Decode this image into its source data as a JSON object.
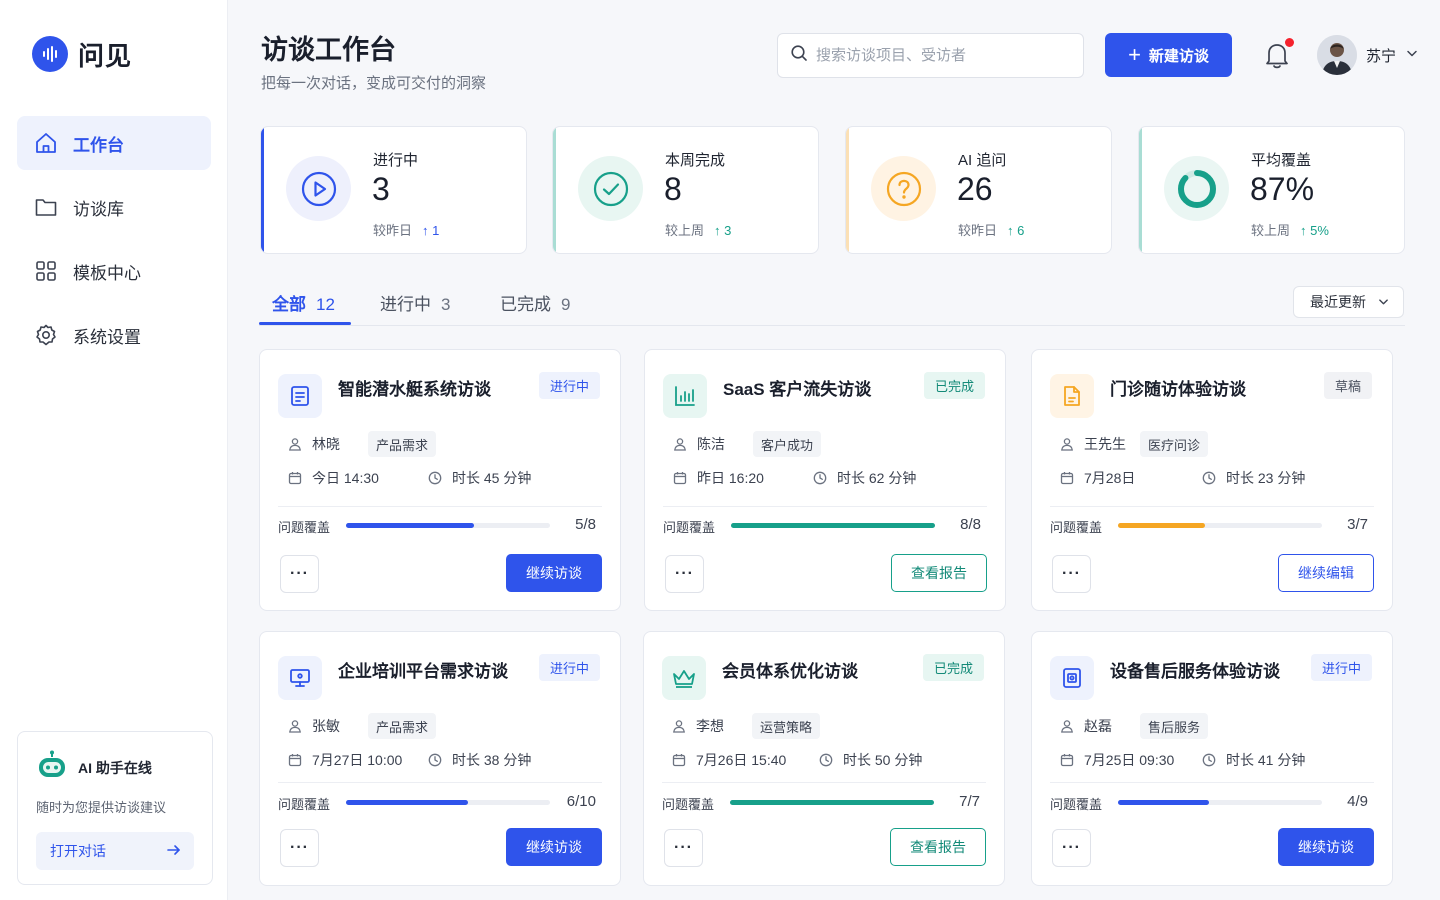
{
  "brand": {
    "name": "问见"
  },
  "nav": [
    {
      "label": "工作台",
      "icon": "home-icon",
      "active": true
    },
    {
      "label": "访谈库",
      "icon": "folder-icon",
      "active": false
    },
    {
      "label": "模板中心",
      "icon": "grid-icon",
      "active": false
    },
    {
      "label": "系统设置",
      "icon": "settings-icon",
      "active": false
    }
  ],
  "assistant": {
    "title": "AI 助手在线",
    "desc": "随时为您提供访谈建议",
    "button": "打开对话"
  },
  "header": {
    "title": "访谈工作台",
    "subtitle": "把每一次对话，变成可交付的洞察",
    "search_placeholder": "搜索访谈项目、受访者",
    "new_button": "新建访谈",
    "user_name": "苏宁"
  },
  "stats": [
    {
      "label": "进行中",
      "value": "3",
      "compare": "较昨日",
      "delta": "↑ 1",
      "color": "#2f54eb",
      "icon": "play-icon"
    },
    {
      "label": "本周完成",
      "value": "8",
      "compare": "较上周",
      "delta": "↑ 3",
      "color": "#17a08a",
      "icon": "check-icon"
    },
    {
      "label": "AI 追问",
      "value": "26",
      "compare": "较昨日",
      "delta": "↑ 6",
      "color": "#f5a623",
      "icon": "question-icon"
    },
    {
      "label": "平均覆盖",
      "value": "87%",
      "compare": "较上周",
      "delta": "↑ 5%",
      "color": "#17a08a",
      "icon": "donut-icon",
      "coverage": 0.87
    }
  ],
  "tabs": [
    {
      "label": "全部",
      "count": "12"
    },
    {
      "label": "进行中",
      "count": "3"
    },
    {
      "label": "已完成",
      "count": "9"
    }
  ],
  "sort": {
    "label": "最近更新"
  },
  "coverage_label": "问题覆盖",
  "more_label": "···",
  "cards": [
    {
      "title": "智能潜水艇系统访谈",
      "status": "进行中",
      "status_type": "blue",
      "person": "林晓",
      "tag": "产品需求",
      "date": "今日 14:30",
      "duration": "时长 45 分钟",
      "coverage": "5/8",
      "covered": 5,
      "total": 8,
      "bar_color": "#2f54eb",
      "action": "继续访谈",
      "action_type": "primary",
      "icon": "document-icon",
      "icon_color": "#2f54eb",
      "icon_bg": "#eef2fd"
    },
    {
      "title": "SaaS 客户流失访谈",
      "status": "已完成",
      "status_type": "green",
      "person": "陈洁",
      "tag": "客户成功",
      "date": "昨日 16:20",
      "duration": "时长 62 分钟",
      "coverage": "8/8",
      "covered": 8,
      "total": 8,
      "bar_color": "#17a08a",
      "action": "查看报告",
      "action_type": "teal",
      "icon": "chart-icon",
      "icon_color": "#17a08a",
      "icon_bg": "#e7f6f2"
    },
    {
      "title": "门诊随访体验访谈",
      "status": "草稿",
      "status_type": "gray",
      "person": "王先生",
      "tag": "医疗问诊",
      "date": "7月28日",
      "duration": "时长 23 分钟",
      "coverage": "3/7",
      "covered": 3,
      "total": 7,
      "bar_color": "#f5a623",
      "action": "继续编辑",
      "action_type": "outline",
      "icon": "file-icon",
      "icon_color": "#f5a623",
      "icon_bg": "#fff4e5"
    },
    {
      "title": "企业培训平台需求访谈",
      "status": "进行中",
      "status_type": "blue",
      "person": "张敏",
      "tag": "产品需求",
      "date": "7月27日 10:00",
      "duration": "时长 38 分钟",
      "coverage": "6/10",
      "covered": 6,
      "total": 10,
      "bar_color": "#2f54eb",
      "action": "继续访谈",
      "action_type": "primary",
      "icon": "monitor-icon",
      "icon_color": "#2f54eb",
      "icon_bg": "#eef2fd"
    },
    {
      "title": "会员体系优化访谈",
      "status": "已完成",
      "status_type": "green",
      "person": "李想",
      "tag": "运营策略",
      "date": "7月26日 15:40",
      "duration": "时长 50 分钟",
      "coverage": "7/7",
      "covered": 7,
      "total": 7,
      "bar_color": "#17a08a",
      "action": "查看报告",
      "action_type": "teal",
      "icon": "crown-icon",
      "icon_color": "#17a08a",
      "icon_bg": "#e7f6f2"
    },
    {
      "title": "设备售后服务体验访谈",
      "status": "进行中",
      "status_type": "blue",
      "person": "赵磊",
      "tag": "售后服务",
      "date": "7月25日 09:30",
      "duration": "时长 41 分钟",
      "coverage": "4/9",
      "covered": 4,
      "total": 9,
      "bar_color": "#2f54eb",
      "action": "继续访谈",
      "action_type": "primary",
      "icon": "device-icon",
      "icon_color": "#2f54eb",
      "icon_bg": "#eef2fd"
    }
  ]
}
